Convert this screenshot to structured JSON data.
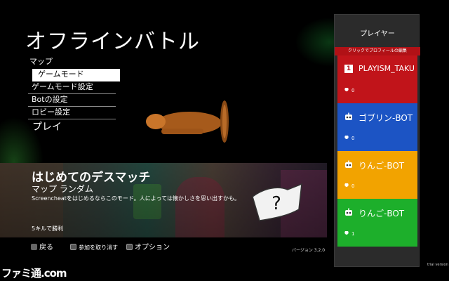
{
  "screen": {
    "title": "オフラインバトル"
  },
  "menu": {
    "items": [
      {
        "label": "マップ"
      },
      {
        "label": "ゲームモード"
      },
      {
        "label": "ゲームモード設定"
      },
      {
        "label": "Botの設定"
      },
      {
        "label": "ロビー設定"
      },
      {
        "label": "プレイ"
      }
    ],
    "selected_index": 1
  },
  "mode_banner": {
    "title": "はじめてのデスマッチ",
    "map": "マップ ランダム",
    "description": "Screencheatをはじめるならこのモード。人によっては懐かしさを思い出すかも。",
    "win_condition": "5キルで勝利"
  },
  "footer": {
    "back_label": "戻る",
    "leave_label": "参加を取り消す",
    "options_label": "オプション",
    "version": "バージョン 3.2.0",
    "trial": "trial version"
  },
  "players_panel": {
    "title": "プレイヤー",
    "hint": "クリックでプロフィールの編集",
    "players": [
      {
        "badge": "1",
        "name": "PLAYISM_TAKU",
        "score": "0",
        "color": "#c1141a"
      },
      {
        "badge": "",
        "name": "ゴブリン-BOT",
        "score": "0",
        "color": "#1c54c4"
      },
      {
        "badge": "",
        "name": "りんご-BOT",
        "score": "0",
        "color": "#f2a300"
      },
      {
        "badge": "",
        "name": "りんご-BOT",
        "score": "1",
        "color": "#1daf2b"
      }
    ]
  },
  "watermark": {
    "text": "ファミ通.com"
  },
  "colors": {
    "panel_bg": "#2b2b2b",
    "hint_bg": "#b11116",
    "selected_bg": "#ffffff"
  }
}
